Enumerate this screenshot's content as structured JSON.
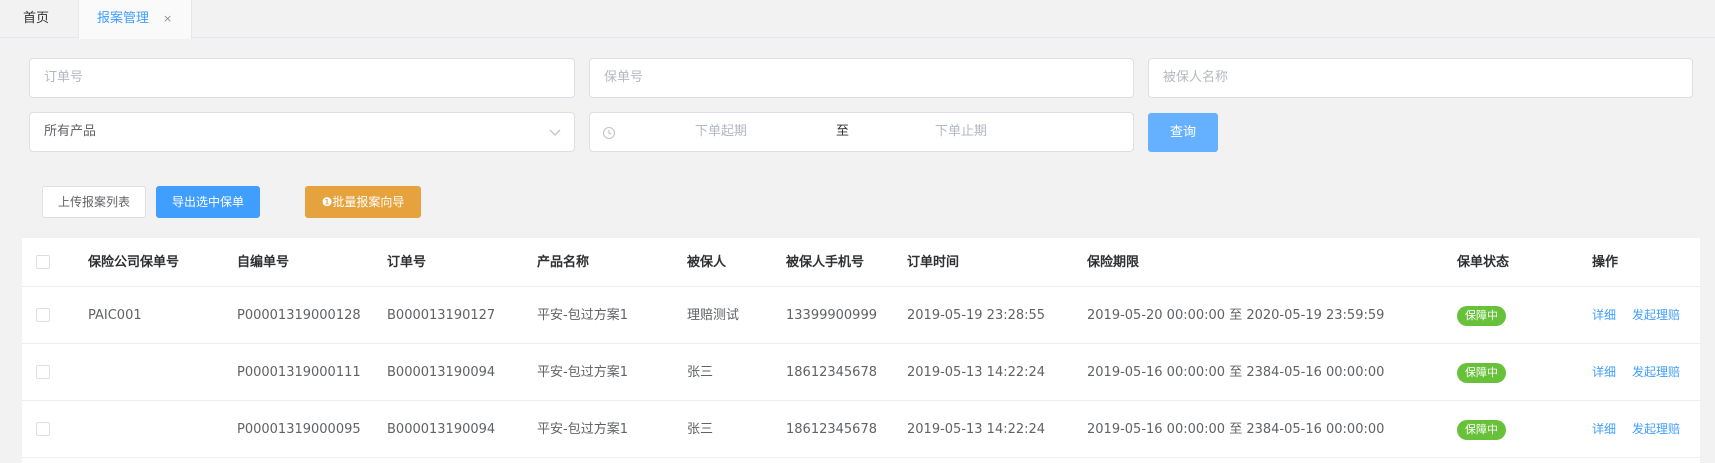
{
  "tabs": {
    "home": "首页",
    "active": "报案管理",
    "close_glyph": "×"
  },
  "filters": {
    "order_no_placeholder": "订单号",
    "policy_no_placeholder": "保单号",
    "insured_name_placeholder": "被保人名称",
    "product_placeholder": "所有产品",
    "date_start_placeholder": "下单起期",
    "date_separator": "至",
    "date_end_placeholder": "下单止期",
    "query_label": "查询"
  },
  "actions": {
    "upload_label": "上传报案列表",
    "export_label": "导出选中保单",
    "batch_label": "❶批量报案向导"
  },
  "table": {
    "columns": [
      "保险公司保单号",
      "自编单号",
      "订单号",
      "产品名称",
      "被保人",
      "被保人手机号",
      "订单时间",
      "保险期限",
      "保单状态",
      "操作"
    ],
    "rows": [
      {
        "company_policy_no": "PAIC001",
        "self_no": "P00001319000128",
        "order_no": "B000013190127",
        "product": "平安-包过方案1",
        "insured": "理赔测试",
        "phone": "13399900999",
        "order_time": "2019-05-19 23:28:55",
        "period": "2019-05-20 00:00:00 至 2020-05-19 23:59:59",
        "status": "保障中",
        "op_detail": "详细",
        "op_claim": "发起理赔"
      },
      {
        "company_policy_no": "",
        "self_no": "P00001319000111",
        "order_no": "B000013190094",
        "product": "平安-包过方案1",
        "insured": "张三",
        "phone": "18612345678",
        "order_time": "2019-05-13 14:22:24",
        "period": "2019-05-16 00:00:00 至 2384-05-16 00:00:00",
        "status": "保障中",
        "op_detail": "详细",
        "op_claim": "发起理赔"
      },
      {
        "company_policy_no": "",
        "self_no": "P00001319000095",
        "order_no": "B000013190094",
        "product": "平安-包过方案1",
        "insured": "张三",
        "phone": "18612345678",
        "order_time": "2019-05-13 14:22:24",
        "period": "2019-05-16 00:00:00 至 2384-05-16 00:00:00",
        "status": "保障中",
        "op_detail": "详细",
        "op_claim": "发起理赔"
      }
    ]
  },
  "colors": {
    "primary": "#409eff",
    "query": "#66b1ff",
    "warning": "#e6a23c",
    "success": "#67c23a"
  },
  "icons": {
    "dropdown": "chevron-down-icon",
    "date": "clock-icon",
    "close": "close-icon"
  }
}
